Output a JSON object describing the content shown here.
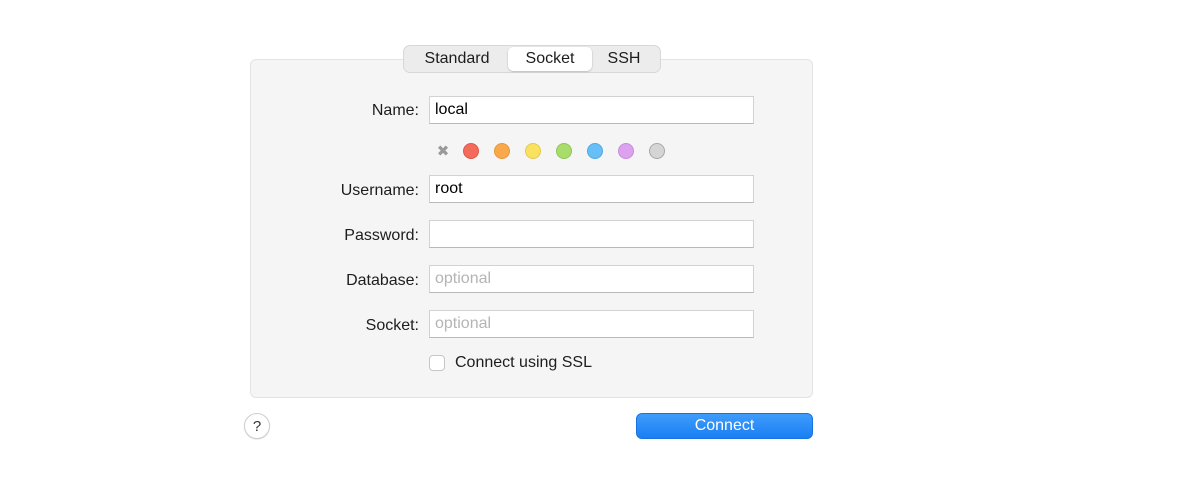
{
  "tabs": [
    {
      "label": "Standard",
      "active": false
    },
    {
      "label": "Socket",
      "active": true
    },
    {
      "label": "SSH",
      "active": false
    }
  ],
  "form": {
    "name_label": "Name:",
    "name_value": "local",
    "username_label": "Username:",
    "username_value": "root",
    "password_label": "Password:",
    "password_value": "",
    "database_label": "Database:",
    "database_placeholder": "optional",
    "socket_label": "Socket:",
    "socket_placeholder": "optional",
    "ssl_label": "Connect using SSL",
    "ssl_checked": false
  },
  "colors": {
    "none_glyph": "✖",
    "swatches": [
      {
        "name": "red",
        "fill": "#f26b5b",
        "border": "#e0564a"
      },
      {
        "name": "orange",
        "fill": "#f9a94b",
        "border": "#e8963a"
      },
      {
        "name": "yellow",
        "fill": "#fbe160",
        "border": "#e3c94c"
      },
      {
        "name": "green",
        "fill": "#a8dd6b",
        "border": "#90c657"
      },
      {
        "name": "blue",
        "fill": "#68bff8",
        "border": "#50a8e3"
      },
      {
        "name": "purple",
        "fill": "#dca2f0",
        "border": "#c78ddb"
      },
      {
        "name": "gray",
        "fill": "#d5d5d5",
        "border": "#a8a8a8"
      }
    ]
  },
  "footer": {
    "help_label": "?",
    "connect_label": "Connect"
  }
}
